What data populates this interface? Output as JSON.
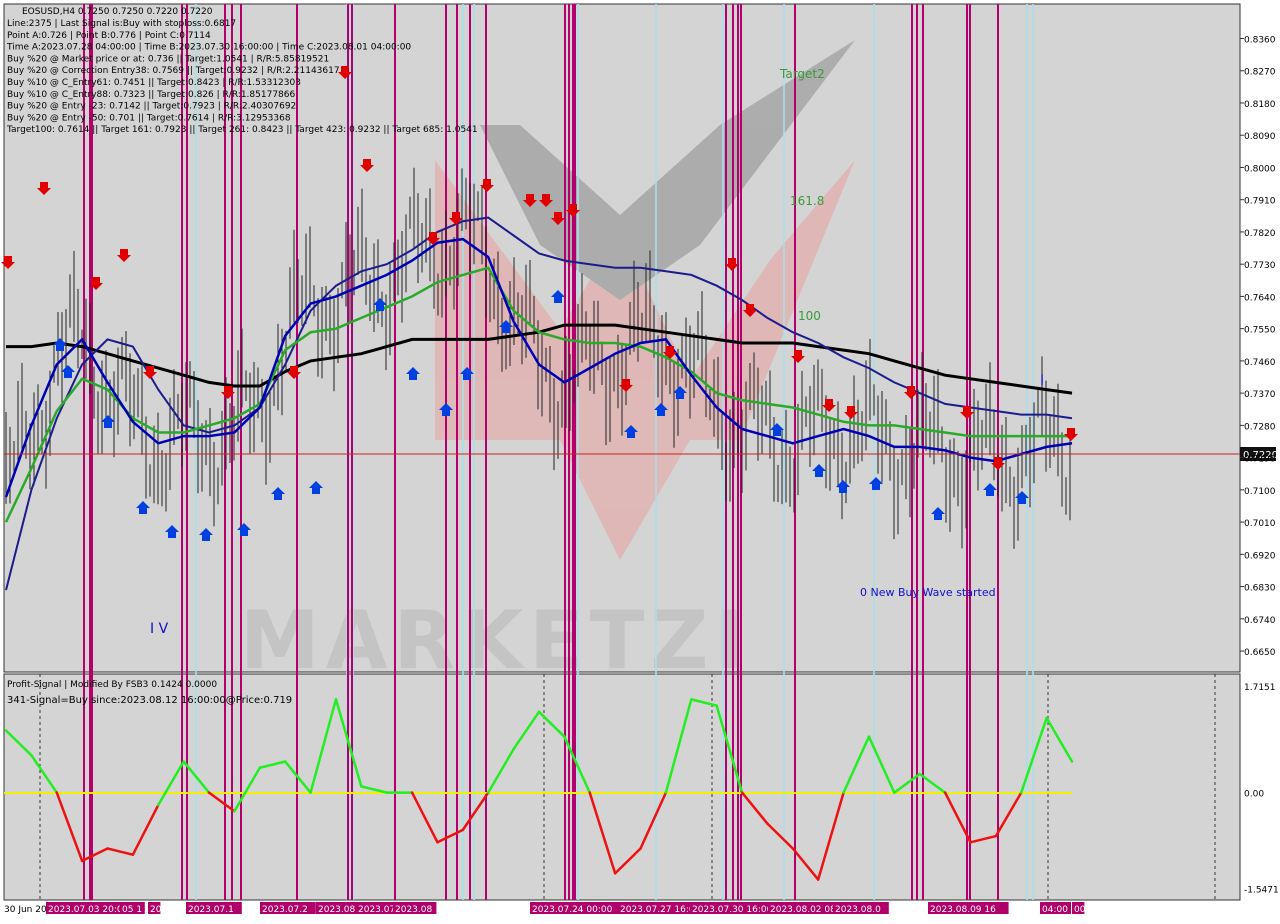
{
  "chart_data": [
    {
      "type": "line",
      "panel": "main",
      "title": "EOSUSD,H4  0.7250 0.7250 0.7220 0.7220",
      "info_lines": [
        "Line:2375 | Last Signal is:Buy with stoploss:0.6817",
        "Point A:0.726 | Point B:0.776 | Point C:0.7114",
        "Time A:2023.07.28 04:00:00 | Time B:2023.07.30 16:00:00 | Time C:2023.08.01 04:00:00",
        "Buy %20 @ Market price or at: 0.736 || Target:1.0541 | R/R:5.85819521",
        "Buy %20 @ Correction Entry38: 0.7569 || Target:0.9232 | R/R:2.21143617",
        "Buy %10 @ C_Entry61: 0.7451 || Target:0.8423 | R/R:1.53312303",
        "Buy %10 @ C_Entry88: 0.7323 || Target:0.826 | R/R:1.85177866",
        "Buy %20 @ Entry -23: 0.7142 || Target:0.7923 | R/R:2.40307692",
        "Buy %20 @ Entry -50: 0.701 || Target:0.7614 | R/R:3.12953368",
        "Target100: 0.7614 || Target 161: 0.7923 || Target 261: 0.8423 || Target 423: 0.9232 || Target 685: 1.0541"
      ],
      "y_ticks": [
        "0.8360",
        "0.8270",
        "0.8180",
        "0.8090",
        "0.8000",
        "0.7910",
        "0.7820",
        "0.7730",
        "0.7640",
        "0.7550",
        "0.7460",
        "0.7370",
        "0.7280",
        "0.7190",
        "0.7100",
        "0.7010",
        "0.6920",
        "0.6830",
        "0.6740",
        "0.6650"
      ],
      "ylim": [
        0.6625,
        0.8434
      ],
      "current_price": "0.7220",
      "annotations": [
        "Target2",
        "161.8",
        "100",
        "0 New Buy Wave started",
        "I V",
        "I"
      ],
      "series": [
        {
          "color": "#000000",
          "values": [
            0.75,
            0.75,
            0.751,
            0.75,
            0.748,
            0.746,
            0.744,
            0.742,
            0.74,
            0.739,
            0.739,
            0.743,
            0.746,
            0.747,
            0.748,
            0.75,
            0.752,
            0.752,
            0.752,
            0.752,
            0.753,
            0.754,
            0.756,
            0.756,
            0.756,
            0.755,
            0.754,
            0.753,
            0.752,
            0.751,
            0.751,
            0.751,
            0.75,
            0.749,
            0.748,
            0.746,
            0.744,
            0.742,
            0.741,
            0.74,
            0.739,
            0.738,
            0.737
          ]
        },
        {
          "color": "#1c1c8c",
          "values": [
            0.682,
            0.71,
            0.73,
            0.745,
            0.752,
            0.75,
            0.738,
            0.728,
            0.726,
            0.728,
            0.733,
            0.745,
            0.76,
            0.767,
            0.771,
            0.773,
            0.777,
            0.782,
            0.785,
            0.786,
            0.781,
            0.776,
            0.774,
            0.773,
            0.772,
            0.772,
            0.771,
            0.77,
            0.767,
            0.763,
            0.758,
            0.754,
            0.751,
            0.747,
            0.744,
            0.74,
            0.737,
            0.734,
            0.733,
            0.732,
            0.731,
            0.731,
            0.73
          ]
        },
        {
          "color": "#2aaa2a",
          "values": [
            0.701,
            0.716,
            0.732,
            0.741,
            0.738,
            0.73,
            0.726,
            0.726,
            0.728,
            0.73,
            0.734,
            0.749,
            0.754,
            0.755,
            0.758,
            0.761,
            0.764,
            0.768,
            0.77,
            0.772,
            0.76,
            0.754,
            0.752,
            0.751,
            0.751,
            0.75,
            0.747,
            0.743,
            0.737,
            0.735,
            0.734,
            0.733,
            0.731,
            0.729,
            0.728,
            0.728,
            0.727,
            0.726,
            0.725,
            0.725,
            0.725,
            0.725,
            0.725
          ]
        },
        {
          "color": "#0000b4",
          "values": [
            0.708,
            0.728,
            0.745,
            0.752,
            0.74,
            0.729,
            0.723,
            0.725,
            0.725,
            0.726,
            0.733,
            0.753,
            0.762,
            0.764,
            0.767,
            0.77,
            0.774,
            0.779,
            0.78,
            0.775,
            0.757,
            0.745,
            0.74,
            0.744,
            0.748,
            0.751,
            0.752,
            0.742,
            0.733,
            0.727,
            0.725,
            0.723,
            0.725,
            0.727,
            0.725,
            0.722,
            0.722,
            0.721,
            0.719,
            0.718,
            0.72,
            0.722,
            0.723
          ]
        }
      ]
    },
    {
      "type": "line",
      "panel": "indicator",
      "title": "Profit-Signal | Modified By FSB3 0.1424 0.0000",
      "subtitle": "341-Signal=Buy since:2023.08.12 16:00:00@Price:0.719",
      "y_ticks": [
        "1.7151",
        "0.00",
        "-1.5471"
      ],
      "ylim": [
        -1.6,
        1.78
      ],
      "values": [
        1.0,
        0.6,
        0.0,
        -1.1,
        -0.9,
        -1.0,
        -0.2,
        0.5,
        0.0,
        -0.3,
        0.4,
        0.5,
        0.0,
        1.5,
        0.1,
        0.0,
        0.0,
        -0.8,
        -0.6,
        0.0,
        0.7,
        1.3,
        0.9,
        0.0,
        -1.3,
        -0.9,
        0.0,
        1.5,
        1.4,
        0.0,
        -0.5,
        -0.9,
        -1.4,
        0.0,
        0.9,
        0.0,
        0.3,
        0.0,
        -0.8,
        -0.7,
        0.0,
        1.2,
        0.5
      ]
    }
  ],
  "x_labels": [
    "30 Jun 20",
    "2023.07.03 20:00",
    "05 1",
    "20",
    "2023.07.1",
    "2023.07.2",
    "2023.08",
    "2023.07.1",
    "2023.08",
    "2023.07.24 00:00",
    "2023.07.27 16:00",
    "2023.07.30 16:00",
    "2023.08.02 08:00",
    "2023.08.0",
    "2023.08.09 16",
    "04:00",
    "00"
  ]
}
